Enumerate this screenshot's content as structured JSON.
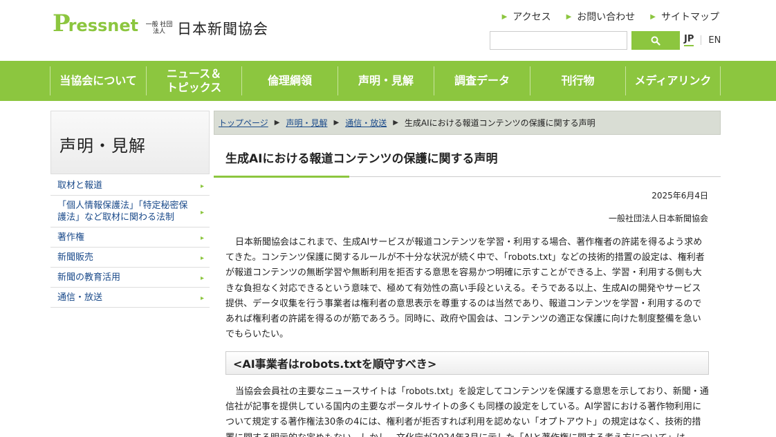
{
  "header": {
    "logo_mark": "P",
    "logo_text": "ressnet",
    "org_small": "一般 社団法人",
    "org_name": "日本新聞協会",
    "util_links": [
      "アクセス",
      "お問い合わせ",
      "サイトマップ"
    ],
    "search_placeholder": "",
    "lang_jp": "JP",
    "lang_en": "EN"
  },
  "gnav": [
    {
      "label": "当協会について"
    },
    {
      "label": "ニュース＆ トピックス"
    },
    {
      "label": "倫理綱領"
    },
    {
      "label": "声明・見解"
    },
    {
      "label": "調査データ"
    },
    {
      "label": "刊行物"
    },
    {
      "label": "メディアリンク"
    }
  ],
  "sidebar": {
    "title": "声明・見解",
    "items": [
      {
        "label": "取材と報道"
      },
      {
        "label": "「個人情報保護法」「特定秘密保護法」など取材に関わる法制"
      },
      {
        "label": "著作権"
      },
      {
        "label": "新聞販売"
      },
      {
        "label": "新聞の教育活用"
      },
      {
        "label": "通信・放送"
      }
    ]
  },
  "breadcrumb": {
    "links": [
      "トップページ",
      "声明・見解",
      "通信・放送"
    ],
    "current": "生成AIにおける報道コンテンツの保護に関する声明"
  },
  "article": {
    "title": "生成AIにおける報道コンテンツの保護に関する声明",
    "date": "2025年6月4日",
    "issuer": "一般社団法人日本新聞協会",
    "para1": "日本新聞協会はこれまで、生成AIサービスが報道コンテンツを学習・利用する場合、著作権者の許諾を得るよう求めてきた。コンテンツ保護に関するルールが不十分な状況が続く中で、「robots.txt」などの技術的措置の設定は、権利者が報道コンテンツの無断学習や無断利用を拒否する意思を容易かつ明確に示すことができる上、学習・利用する側も大きな負担なく対応できるという意味で、極めて有効性の高い手段といえる。そうである以上、生成AIの開発やサービス提供、データ収集を行う事業者は権利者の意思表示を尊重するのは当然であり、報道コンテンツを学習・利用するのであれば権利者の許諾を得るのが筋であろう。同時に、政府や国会は、コンテンツの適正な保護に向けた制度整備を急いでもらいたい。",
    "subheading": "<AI事業者はrobots.txtを順守すべき>",
    "para2": "当協会会員社の主要なニュースサイトは「robots.txt」を設定してコンテンツを保護する意思を示しており、新聞・通信社が記事を提供している国内の主要なポータルサイトの多くも同様の設定をしている。AI学習における著作物利用について規定する著作権法30条の4には、権利者が拒否すれば利用を認めない「オプトアウト」の規定はなく、技術的措置に関する明示的な定めもない。しかし、文化庁が2024年3月に示した「AIと著作権に関する考え方について」は、"
  },
  "colors": {
    "brand_green": "#8cc63f",
    "link_blue": "#1a4a8a"
  }
}
